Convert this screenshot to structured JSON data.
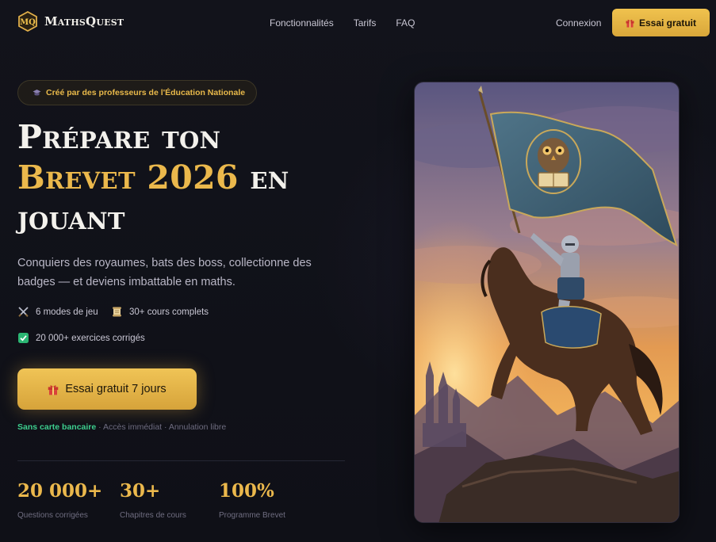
{
  "brand": {
    "logo_initials": "MQ",
    "name": "MathsQuest"
  },
  "nav": {
    "links": [
      "Fonctionnalités",
      "Tarifs",
      "FAQ"
    ],
    "login": "Connexion",
    "cta": "Essai gratuit"
  },
  "hero": {
    "badge": "Créé par des professeurs de l'Éducation Nationale",
    "headline": {
      "line1": "Prépare ton",
      "highlight": "Brevet 2026",
      "after_highlight": "en",
      "line3": "jouant"
    },
    "subtitle": "Conquiers des royaumes, bats des boss, collectionne des badges — et deviens imbattable en maths.",
    "features": [
      {
        "icon": "crossed-swords-icon",
        "label": "6 modes de jeu"
      },
      {
        "icon": "scroll-icon",
        "label": "30+ cours complets"
      },
      {
        "icon": "check-box-icon",
        "label": "20 000+ exercices corrigés"
      }
    ],
    "cta": "Essai gratuit 7 jours",
    "note": {
      "highlight": "Sans carte bancaire",
      "rest": " · Accès immédiat · Annulation libre"
    }
  },
  "stats": [
    {
      "value": "20 000+",
      "label": "Questions corrigées"
    },
    {
      "value": "30+",
      "label": "Chapitres de cours"
    },
    {
      "value": "100%",
      "label": "Programme Brevet"
    }
  ],
  "colors": {
    "accent_gold": "#ebb84c",
    "success_green": "#3ecf8e",
    "background": "#0f1017"
  }
}
